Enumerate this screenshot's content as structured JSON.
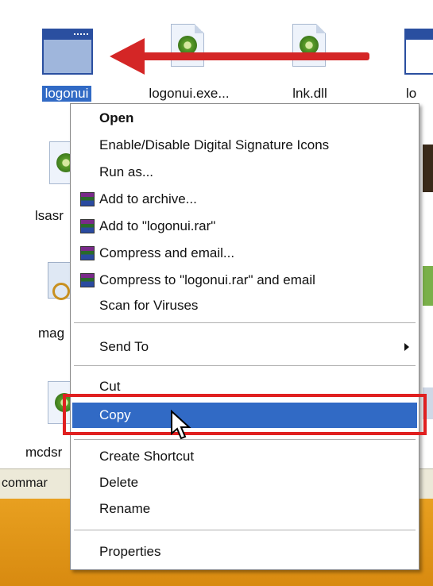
{
  "desktop": {
    "icons": [
      {
        "label": "logonui",
        "selected": true,
        "icon": "window-icon"
      },
      {
        "label": "logonui.exe...",
        "icon": "exe-icon"
      },
      {
        "label": "lnk.dll",
        "icon": "dll-icon"
      },
      {
        "label": "lo",
        "icon": "window-icon"
      },
      {
        "label": "lsasr",
        "icon": "exe-icon"
      },
      {
        "label": "mag",
        "icon": "magnifier-icon"
      },
      {
        "label": "mcdsr",
        "icon": "exe-icon"
      }
    ]
  },
  "taskbar": {
    "command_label": "commar"
  },
  "context_menu": {
    "items": [
      {
        "label": "Open",
        "bold": true
      },
      {
        "label": "Enable/Disable Digital Signature Icons"
      },
      {
        "label": "Run as..."
      },
      {
        "label": "Add to archive...",
        "icon": "winrar-icon"
      },
      {
        "label": "Add to \"logonui.rar\"",
        "icon": "winrar-icon"
      },
      {
        "label": "Compress and email...",
        "icon": "winrar-icon"
      },
      {
        "label": "Compress to \"logonui.rar\" and email",
        "icon": "winrar-icon"
      },
      {
        "label": "Scan for Viruses"
      },
      {
        "label": "Send To",
        "submenu": true
      },
      {
        "label": "Cut"
      },
      {
        "label": "Copy",
        "highlighted": true
      },
      {
        "label": "Create Shortcut"
      },
      {
        "label": "Delete"
      },
      {
        "label": "Rename"
      },
      {
        "label": "Properties"
      }
    ]
  },
  "colors": {
    "selection": "#316ac5",
    "annotation_red": "#e02020",
    "taskbar_orange": "#e8a020"
  }
}
